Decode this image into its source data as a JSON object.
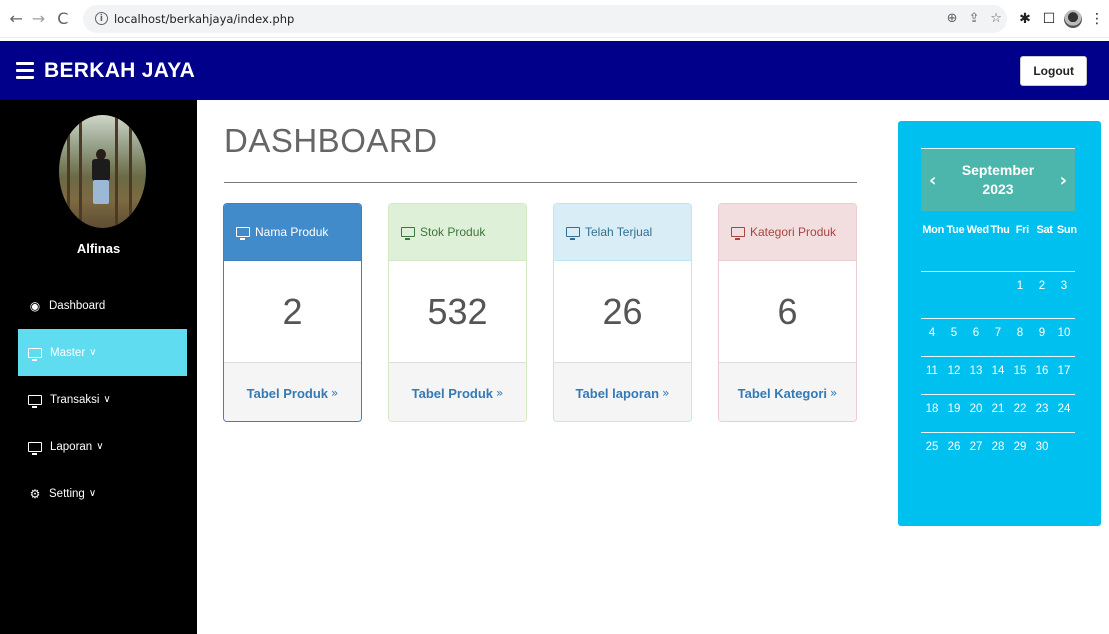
{
  "browser": {
    "url": "localhost/berkahjaya/index.php",
    "info_symbol": "i"
  },
  "header": {
    "brand": "BERKAH JAYA",
    "logout_label": "Logout",
    "bg_color": "#01008b"
  },
  "sidebar": {
    "user_name": "Alfinas",
    "items": [
      {
        "label": "Dashboard",
        "icon": "dashboard-icon",
        "active": false,
        "caret": ""
      },
      {
        "label": "Master",
        "icon": "desktop-icon",
        "active": true,
        "caret": "∨"
      },
      {
        "label": "Transaksi",
        "icon": "desktop-icon",
        "active": false,
        "caret": "∨"
      },
      {
        "label": "Laporan",
        "icon": "desktop-icon",
        "active": false,
        "caret": "∨"
      },
      {
        "label": "Setting",
        "icon": "cog-icon",
        "active": false,
        "caret": "∨"
      }
    ],
    "active_color": "#5fdcf0"
  },
  "main": {
    "title": "DASHBOARD",
    "cards": [
      {
        "title": "Nama Produk",
        "value": "2",
        "link": "Tabel Produk",
        "chevron": "»",
        "color": "#428bca"
      },
      {
        "title": "Stok Produk",
        "value": "532",
        "link": "Tabel Produk",
        "chevron": "»",
        "color": "#dff0d8"
      },
      {
        "title": "Telah Terjual",
        "value": "26",
        "link": "Tabel laporan",
        "chevron": "»",
        "color": "#d9edf7"
      },
      {
        "title": "Kategori Produk",
        "value": "6",
        "link": "Tabel Kategori",
        "chevron": "»",
        "color": "#f2dede"
      }
    ]
  },
  "calendar": {
    "month": "September",
    "year": "2023",
    "prev": "‹",
    "next": "›",
    "days": [
      "Mon",
      "Tue",
      "Wed",
      "Thu",
      "Fri",
      "Sat",
      "Sun"
    ],
    "weeks": [
      [
        "",
        "",
        "",
        "",
        "1",
        "2",
        "3"
      ],
      [
        "4",
        "5",
        "6",
        "7",
        "8",
        "9",
        "10"
      ],
      [
        "11",
        "12",
        "13",
        "14",
        "15",
        "16",
        "17"
      ],
      [
        "18",
        "19",
        "20",
        "21",
        "22",
        "23",
        "24"
      ],
      [
        "25",
        "26",
        "27",
        "28",
        "29",
        "30",
        ""
      ]
    ],
    "bg_color": "#00c0ef"
  }
}
